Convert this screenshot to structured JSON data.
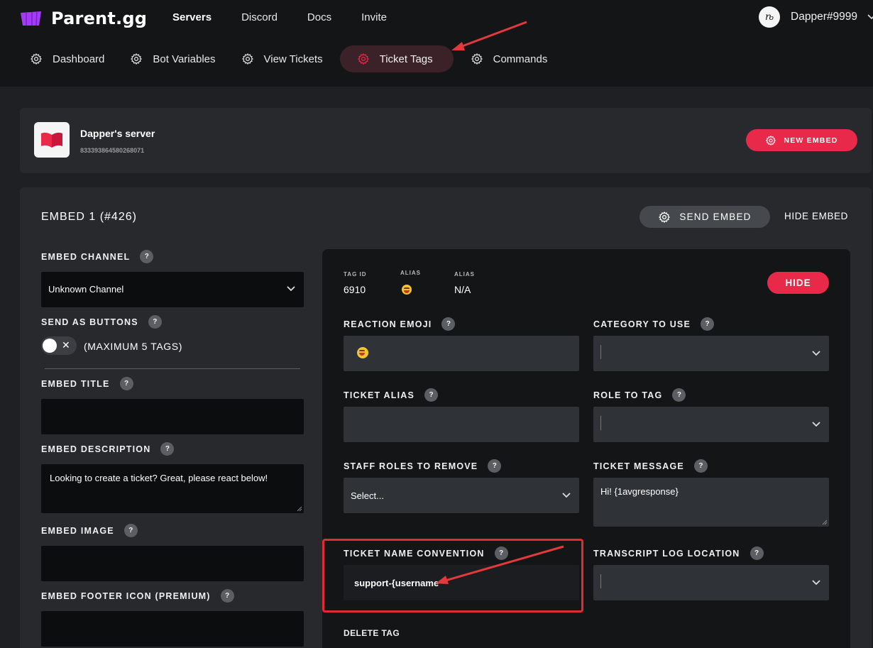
{
  "app": {
    "name": "Parent.gg"
  },
  "topnav": [
    "Servers",
    "Discord",
    "Docs",
    "Invite"
  ],
  "user": {
    "avatar_text": "ѣ",
    "name": "Dapper#9999"
  },
  "subnav": [
    "Dashboard",
    "Bot Variables",
    "View Tickets",
    "Ticket Tags",
    "Commands"
  ],
  "server": {
    "name": "Dapper's server",
    "id": "833393864580268071",
    "new_embed": "NEW EMBED"
  },
  "embed": {
    "title": "EMBED 1 (#426)",
    "send": "SEND EMBED",
    "hide": "HIDE EMBED",
    "channel_label": "EMBED CHANNEL",
    "channel_value": "Unknown Channel",
    "buttons_label": "SEND AS BUTTONS",
    "toggle_x": "✕",
    "max_tags": "(MAXIMUM 5 TAGS)",
    "title_label": "EMBED TITLE",
    "description_label": "EMBED DESCRIPTION",
    "description_value": "Looking to create a ticket? Great, please react below!",
    "image_label": "EMBED IMAGE",
    "footer_label": "EMBED FOOTER ICON (PREMIUM)"
  },
  "help": "?",
  "tag": {
    "id_label": "TAG ID",
    "id_value": "6910",
    "alias_label": "ALIAS",
    "alias2_label": "ALIAS",
    "alias2_value": "N/A",
    "hide": "HIDE",
    "reaction_label": "REACTION EMOJI",
    "category_label": "CATEGORY TO USE",
    "alias_field_label": "TICKET ALIAS",
    "role_label": "ROLE TO TAG",
    "staff_label": "STAFF ROLES TO REMOVE",
    "staff_value": "Select...",
    "message_label": "TICKET MESSAGE",
    "message_value": "Hi! {1avgresponse}",
    "name_conv_label": "TICKET NAME CONVENTION",
    "name_conv_value": "support-{username",
    "transcript_label": "TRANSCRIPT LOG LOCATION",
    "delete": "DELETE TAG"
  },
  "colors": {
    "accent": "#e8294a",
    "highlight": "#e02a34",
    "brand": "#a23cf5"
  }
}
